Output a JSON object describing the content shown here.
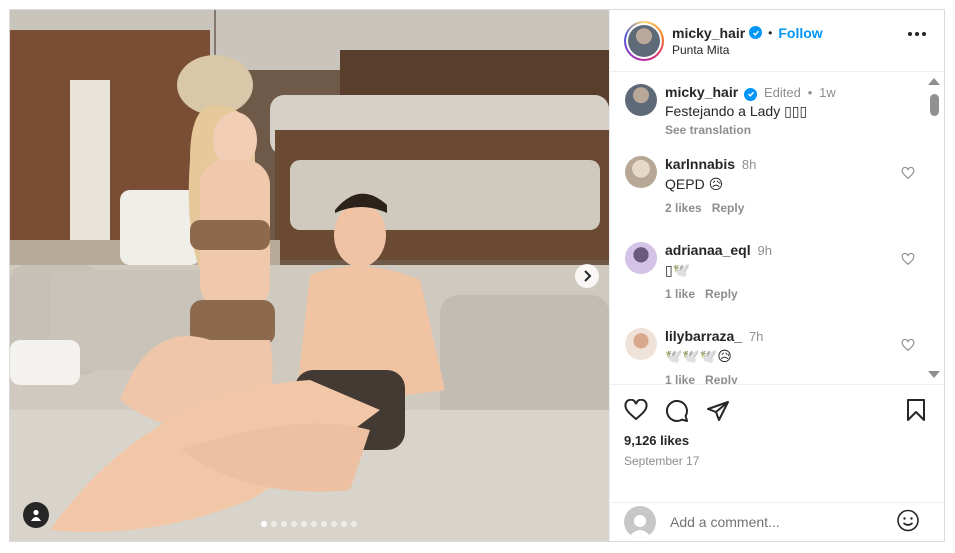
{
  "header": {
    "username": "micky_hair",
    "separator": "•",
    "follow_label": "Follow",
    "location": "Punta Mita"
  },
  "caption": {
    "username": "micky_hair",
    "edited": "Edited",
    "time": "1w",
    "text": "Festejando a Lady ▯▯▯",
    "see_translation": "See translation"
  },
  "comments": [
    {
      "username": "karlnnabis",
      "time": "8h",
      "text": "QEPD 😥",
      "likes": "2 likes",
      "reply": "Reply"
    },
    {
      "username": "adrianaa_eql",
      "time": "9h",
      "text": "▯🕊️",
      "likes": "1 like",
      "reply": "Reply"
    },
    {
      "username": "lilybarraza_",
      "time": "7h",
      "text": "🕊️🕊️🕊️😥",
      "likes": "1 like",
      "reply": "Reply"
    }
  ],
  "actions": {
    "likes": "9,126 likes",
    "date": "September 17"
  },
  "add_comment": {
    "placeholder": "Add a comment..."
  },
  "carousel": {
    "total": 10,
    "active": 1
  },
  "colors": {
    "accent": "#0095f6",
    "text": "#262626",
    "muted": "#8e8e8e",
    "border": "#dbdbdb"
  }
}
